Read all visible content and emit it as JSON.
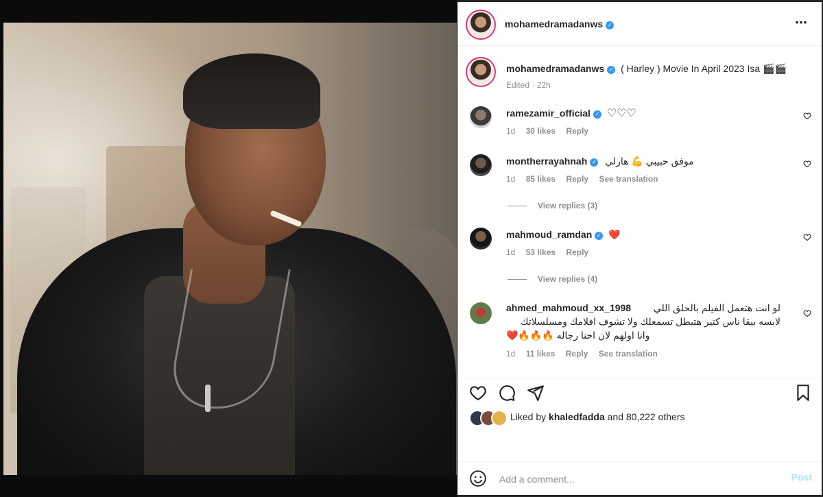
{
  "post": {
    "username": "mohamedramadanws",
    "caption": "( Harley ) Movie In April 2023 Isa",
    "caption_emoji": "🎬🎬",
    "edited_label": "Edited · 22h"
  },
  "comments": [
    {
      "username": "ramezamir_official",
      "text": "",
      "hearts": "♡♡♡",
      "time": "1d",
      "likes": "30 likes",
      "reply": "Reply"
    },
    {
      "username": "montherrayahnah",
      "text": "موفق حبيبي 💪 هارلي",
      "time": "1d",
      "likes": "85 likes",
      "reply": "Reply",
      "translate": "See translation",
      "view_replies": "View replies (3)"
    },
    {
      "username": "mahmoud_ramdan",
      "text": "❤️",
      "time": "1d",
      "likes": "53 likes",
      "reply": "Reply",
      "view_replies": "View replies (4)"
    },
    {
      "username": "ahmed_mahmoud_xx_1998",
      "line1": "لو انت هتعمل الفيلم بالحلق اللي",
      "line2": "لابسه بيقا ناس كتير هتبطل تسمعلك ولا تشوف افلامك ومسلسلاتك",
      "line3": "وانا اولهم لان احنا رجاله 🔥🔥🔥❤️",
      "time": "1d",
      "likes": "11 likes",
      "reply": "Reply",
      "translate": "See translation"
    }
  ],
  "likes": {
    "prefix": "Liked by",
    "user": "khaledfadda",
    "suffix": "and 80,222 others"
  },
  "add_comment": {
    "placeholder": "Add a comment...",
    "post_label": "Post"
  },
  "icons": {
    "more": "⋯"
  },
  "colors": {
    "verified": "#3897f0",
    "post_button": "#b2dffc",
    "muted": "#8e8e8e"
  }
}
